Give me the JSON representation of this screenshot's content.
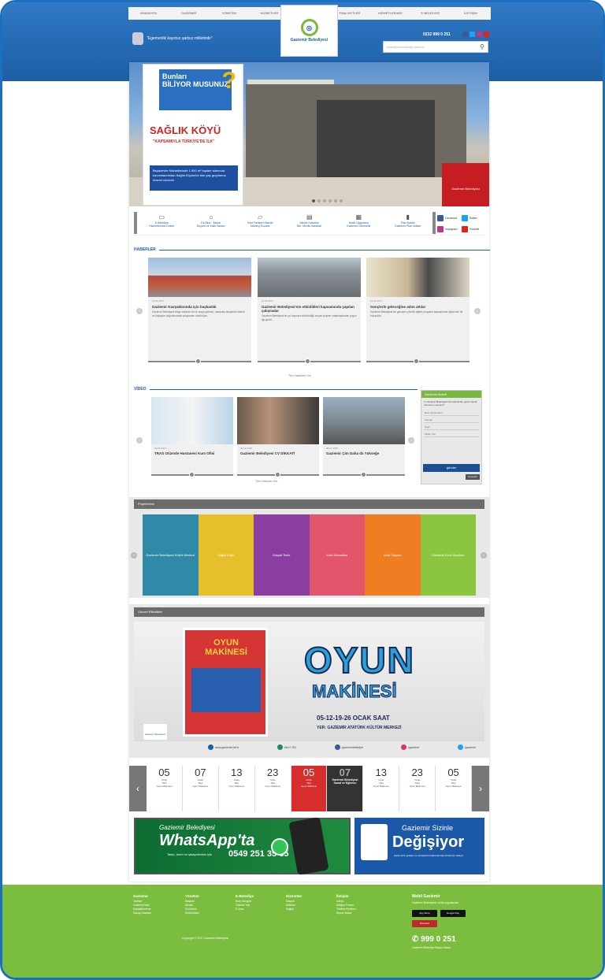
{
  "colors": {
    "brand_blue": "#1a5fa8",
    "brand_green": "#7bbd3e",
    "alert_red": "#d72d2d"
  },
  "nav": {
    "items": [
      "ANASAYFA",
      "GAZİEMİR",
      "YÖNETİM",
      "HİZMETLER",
      "FAALİYETLER",
      "HİZMETLERİMİZ",
      "E-BELEDİYE",
      "İLETİŞİM"
    ]
  },
  "header": {
    "logo_text": "Gaziemir Belediyesi",
    "motto": "\"Egemenlik kayıtsız şartsız milletindir\"",
    "phone": "0232 999 0 251",
    "search_placeholder": "Aradığınız kelimeyi yazınız"
  },
  "hero": {
    "ask_top": "Bunları",
    "ask_main": "BİLİYOR MUSUNUZ",
    "title": "SAĞLIK KÖYÜ",
    "subtitle": "\"KAPSAMIYLA TÜRKİYE'DE İLK\"",
    "box_text": "Beyazevler Mahallesinde 1.500 m² toplam alanında konumlandırılan Sağlık Köyümüz tüm yaş gruplarına hizmet verecek",
    "brand": "Gaziemir Belediyesi"
  },
  "quick_links": [
    {
      "title": "E-Belediye",
      "sub": "Hizmetlerimiz Online"
    },
    {
      "title": "Ek Bina - İlanlar",
      "sub": "Duyuru ve İhale İlanları"
    },
    {
      "title": "Kent Rehberi Hizmet",
      "sub": "Nöbetçi Eczane"
    },
    {
      "title": "Meclis Kararları",
      "sub": "Bel. Meclis Kararları"
    },
    {
      "title": "Mobil Uygulama",
      "sub": "Gaziemir Cebinizde"
    },
    {
      "title": "Plan Notları",
      "sub": "Gaziemir Plan Notları"
    }
  ],
  "social_quick": [
    "Facebook",
    "Twitter",
    "Instagram",
    "Youtube"
  ],
  "news": {
    "heading": "HABERLER",
    "more": "Tüm Haberleri Gör",
    "items": [
      {
        "meta": "12.01.2017",
        "title": "Gaziemir Kavşaklarında için başkanlık",
        "desc": "Gaziemir Belediyesi bölge sakinleri ile bir araya gelerek, vatandaş taleplerini dinledi ve ihtiyaçlar doğrultusunda çalışmaları sürdürüyor."
      },
      {
        "meta": "11.01.2017",
        "title": "Gaziemir Belediyesi'nin etkinlikleri kapsamında yapılan çalışmalar",
        "desc": "Gaziemir Belediyesi'nin yıl boyunca sürdürdüğü sosyal projeler vatandaşlardan yoğun ilgi gördü."
      },
      {
        "meta": "10.01.2017",
        "title": "Gençlerle geleceğine adım attılar",
        "desc": "Gaziemir Belediyesi'nin gençlere yönelik eğitim programı kapsamında öğrenciler ile buluşuldu."
      }
    ]
  },
  "video": {
    "heading": "VİDEO",
    "more": "Tüm Videoları Gör",
    "items": [
      {
        "meta": "02.01.2017",
        "title": "TRAS Otizmde Hastanesi Kum Ofisi"
      },
      {
        "meta": "30.12.2016",
        "title": "Gaziemir Belediyesi CV DİKKATİ"
      },
      {
        "meta": "28.12.2016",
        "title": "Gaziemir Çim Daha da Yükseğe"
      }
    ]
  },
  "survey": {
    "title": "Gaziemir Anketi",
    "question": "3. Gaziemir Belediyesi hizmetlerinden genel olarak memnun musunuz?",
    "options": [
      "Evet memnunum",
      "Kısmen",
      "Hayır",
      "Fikrim yok"
    ],
    "vote": "gönder",
    "results": "Sonuçlar"
  },
  "projects": {
    "heading": "Projelerimiz",
    "tiles": [
      "Gaziemir Belediyesi Kültür Merkezi",
      "Sağlık Köyü",
      "Sosyal Tesis",
      "Kent Hizmetleri",
      "Kent Yaşamı",
      "Gaziemir Kent Meydanı"
    ]
  },
  "events": {
    "heading": "Güncel Etkinlikler",
    "banner_title": "OYUN",
    "banner_sub": "MAKİNESİ",
    "dates": "05-12-19-26 OCAK",
    "saat": "SAAT",
    "venue": "YER: GAZİEMİR ATATÜRK KÜLTÜR MERKEZİ",
    "poster_title": "OYUN MAKİNESİ",
    "brand": "Gaziemir Belediyesi"
  },
  "banner_links": [
    "www.gaziemir.bel.tr",
    "444 0 251",
    "/gaziemirbelediye",
    "/gaziemir",
    "/gaziemir"
  ],
  "calendar": [
    {
      "n": "05",
      "m": "Ocak",
      "t": "TEA",
      "s": "Oyun Makinesi"
    },
    {
      "n": "07",
      "m": "Ocak",
      "t": "TEA",
      "s": "Oyun Makinesi"
    },
    {
      "n": "13",
      "m": "Ocak",
      "t": "TEA",
      "s": "Oyun Makinesi"
    },
    {
      "n": "23",
      "m": "Ocak",
      "t": "TEA",
      "s": "Oyun Makinesi"
    },
    {
      "n": "05",
      "m": "Ocak",
      "t": "TEA",
      "s": "Oyun Makinesi"
    },
    {
      "n": "07",
      "m": "Ocak",
      "t": "Gaziemir Belediyesi",
      "s": "Sanat ve Eğlence"
    },
    {
      "n": "13",
      "m": "Ocak",
      "t": "TEA",
      "s": "Oyun Makinesi"
    },
    {
      "n": "23",
      "m": "Ocak",
      "t": "TEA",
      "s": "Oyun Makinesi"
    },
    {
      "n": "05",
      "m": "Ocak",
      "t": "TEA",
      "s": "Oyun Makinesi"
    }
  ],
  "whatsapp": {
    "line1": "Gaziemir Belediyesi",
    "line2": "WhatsApp'ta",
    "number": "0549 251 35 35",
    "note": "Talep, öneri ve şikayetleriniz için"
  },
  "degisiyor": {
    "line1": "Gaziemir Sizinle",
    "line2": "Değişiyor",
    "note": "Gaziemir'in gelişimi ve dönüşümü hakkında bilgi almak için tıklayın"
  },
  "footer": {
    "cols": [
      {
        "title": "Gaziemir",
        "links": [
          "Tarihçe",
          "Gaziemir'imiz",
          "Mahallelerimiz",
          "Sanayi Alanları"
        ]
      },
      {
        "title": "Yönetim",
        "links": [
          "Başkan",
          "Meclis",
          "Encümen",
          "Müdürlükler"
        ]
      },
      {
        "title": "E-Belediye",
        "links": [
          "Borç Sorgula",
          "Ödeme Yap",
          "E-İmar"
        ]
      },
      {
        "title": "Hizmetler",
        "links": [
          "Sosyal",
          "Kültürel",
          "Sağlık"
        ]
      },
      {
        "title": "İletişim",
        "links": [
          "Adres",
          "İletişim Formu",
          "Telefon Rehberi",
          "Beyaz Masa"
        ]
      }
    ],
    "copyright": "Copyright © 2017 Gaziemir Belediyesi",
    "mobile": "Mobil Gaziemir",
    "mobile_sub": "Gaziemir Belediyesi mobil uygulaması",
    "store1": "App Store",
    "store2": "Google Play",
    "store3": "Windows",
    "call": "999 0 251",
    "call_sub": "Gaziemir Belediye Beyaz Masa"
  }
}
